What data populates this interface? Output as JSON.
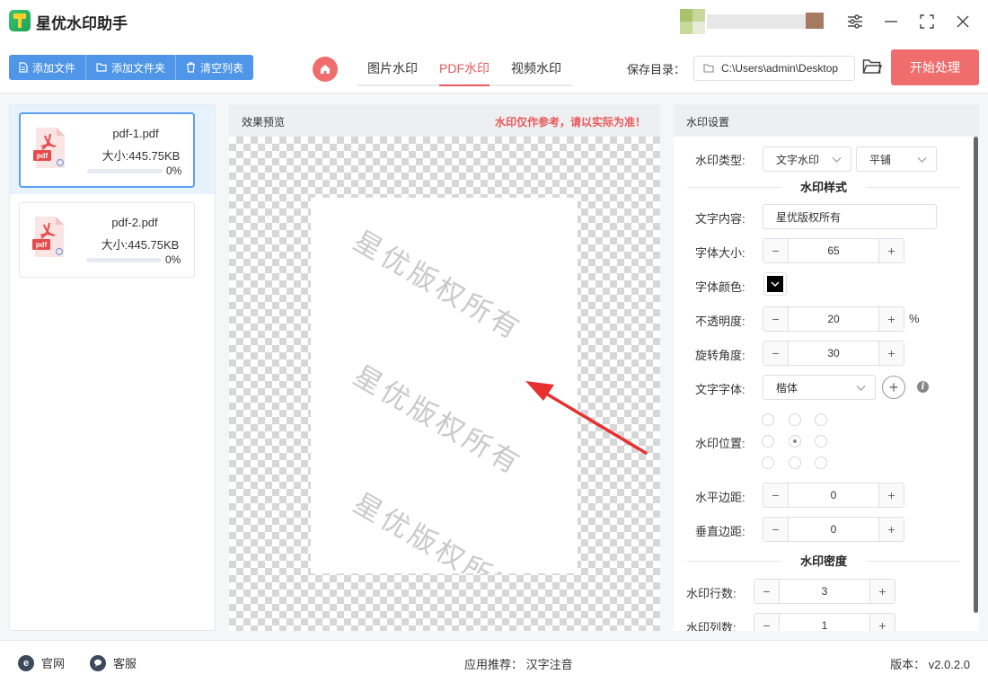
{
  "app": {
    "title": "星优水印助手"
  },
  "toolbar": {
    "add_file": "添加文件",
    "add_folder": "添加文件夹",
    "clear_list": "清空列表",
    "tabs": [
      {
        "label": "图片水印",
        "active": false
      },
      {
        "label": "PDF水印",
        "active": true
      },
      {
        "label": "视频水印",
        "active": false
      }
    ],
    "save_label": "保存目录：",
    "save_path": "C:\\Users\\admin\\Desktop",
    "start_button": "开始处理"
  },
  "files": [
    {
      "name": "pdf-1.pdf",
      "size": "大小:445.75KB",
      "progress": "0%",
      "selected": true
    },
    {
      "name": "pdf-2.pdf",
      "size": "大小:445.75KB",
      "progress": "0%",
      "selected": false
    }
  ],
  "preview": {
    "title": "效果预览",
    "note": "水印仅作参考，请以实际为准！",
    "watermark_text": "星优版权所有"
  },
  "settings": {
    "title": "水印设置",
    "type_label": "水印类型:",
    "type_value": "文字水印",
    "layout_value": "平铺",
    "style_section": "水印样式",
    "text_label": "文字内容:",
    "text_value": "星优版权所有",
    "size_label": "字体大小:",
    "size_value": "65",
    "color_label": "字体颜色:",
    "color_value": "#000000",
    "opacity_label": "不透明度:",
    "opacity_value": "20",
    "opacity_unit": "%",
    "rotation_label": "旋转角度:",
    "rotation_value": "30",
    "font_label": "文字字体:",
    "font_value": "楷体",
    "position_label": "水印位置:",
    "hmargin_label": "水平边距:",
    "hmargin_value": "0",
    "vmargin_label": "垂直边距:",
    "vmargin_value": "0",
    "density_section": "水印密度",
    "rows_label": "水印行数:",
    "rows_value": "3",
    "cols_label": "水印列数:",
    "cols_value": "1"
  },
  "footer": {
    "website": "官网",
    "support": "客服",
    "recommend": "应用推荐：  汉字注音",
    "version": "版本：  v2.0.2.0"
  },
  "colors": {
    "accent_red": "#f06d6d",
    "accent_blue": "#4f95e8",
    "tab_active": "#e8595b"
  }
}
